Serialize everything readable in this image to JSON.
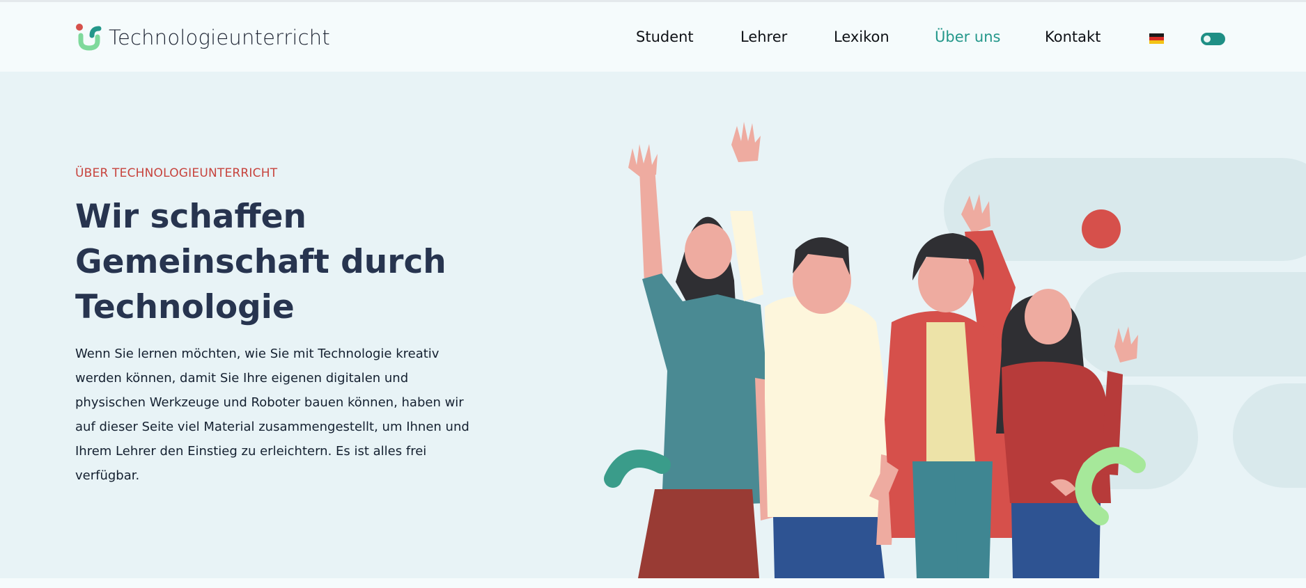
{
  "brand": {
    "name": "Technologieunterricht",
    "accent": "#23978a",
    "primary_red": "#d6504b"
  },
  "nav": {
    "items": [
      {
        "label": "Student",
        "active": false
      },
      {
        "label": "Lehrer",
        "active": false
      },
      {
        "label": "Lexikon",
        "active": false
      },
      {
        "label": "Über uns",
        "active": true
      },
      {
        "label": "Kontakt",
        "active": false
      }
    ],
    "language_icon": "german-flag-icon",
    "theme_toggle_icon": "toggle-switch-icon"
  },
  "hero": {
    "eyebrow": "ÜBER TECHNOLOGIEUNTERRICHT",
    "headline_lines": [
      "Wir schaffen",
      "Gemeinschaft durch",
      "Technologie"
    ],
    "body_lines": [
      "Wenn Sie lernen möchten, wie Sie mit Technologie kreativ",
      "werden können, damit Sie Ihre eigenen digitalen und",
      "physischen Werkzeuge und Roboter bauen können, haben wir",
      "auf dieser Seite viel Material zusammengestellt, um Ihnen und",
      "Ihrem Lehrer den Einstieg zu erleichtern. Es ist alles frei",
      "verfügbar."
    ],
    "illustration_icon": "waving-group-illustration"
  }
}
